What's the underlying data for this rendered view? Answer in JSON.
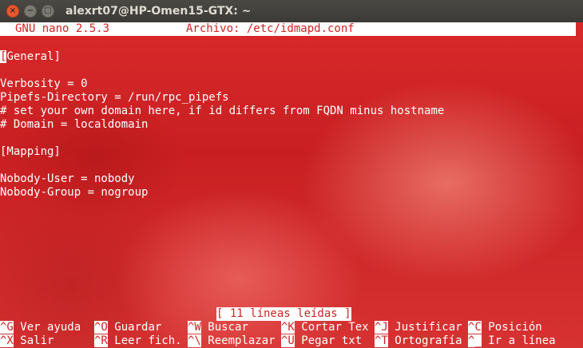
{
  "window": {
    "title": "alexrt07@HP-Omen15-GTX: ~",
    "close_glyph": "×",
    "min_glyph": "−",
    "max_glyph": "□"
  },
  "nano": {
    "version": "GNU nano 2.5.3",
    "file_label": "Archivo: /etc/idmapd.conf",
    "lines": [
      "[General]",
      "",
      "Verbosity = 0",
      "Pipefs-Directory = /run/rpc_pipefs",
      "# set your own domain here, if id differs from FQDN minus hostname",
      "# Domain = localdomain",
      "",
      "[Mapping]",
      "",
      "Nobody-User = nobody",
      "Nobody-Group = nogroup"
    ],
    "status": "[ 11 líneas leídas ]",
    "shortcuts_row1": [
      {
        "key": "^G",
        "label": "Ver ayuda"
      },
      {
        "key": "^O",
        "label": "Guardar"
      },
      {
        "key": "^W",
        "label": "Buscar"
      },
      {
        "key": "^K",
        "label": "Cortar Tex"
      },
      {
        "key": "^J",
        "label": "Justificar"
      },
      {
        "key": "^C",
        "label": "Posición"
      }
    ],
    "shortcuts_row2": [
      {
        "key": "^X",
        "label": "Salir"
      },
      {
        "key": "^R",
        "label": "Leer fich."
      },
      {
        "key": "^\\",
        "label": "Reemplazar"
      },
      {
        "key": "^U",
        "label": "Pegar txt"
      },
      {
        "key": "^T",
        "label": "Ortografía"
      },
      {
        "key": "^_",
        "label": "Ir a línea"
      }
    ]
  },
  "colors": {
    "background_accent": "#cf2323",
    "inverse_text": "#ffffff"
  }
}
